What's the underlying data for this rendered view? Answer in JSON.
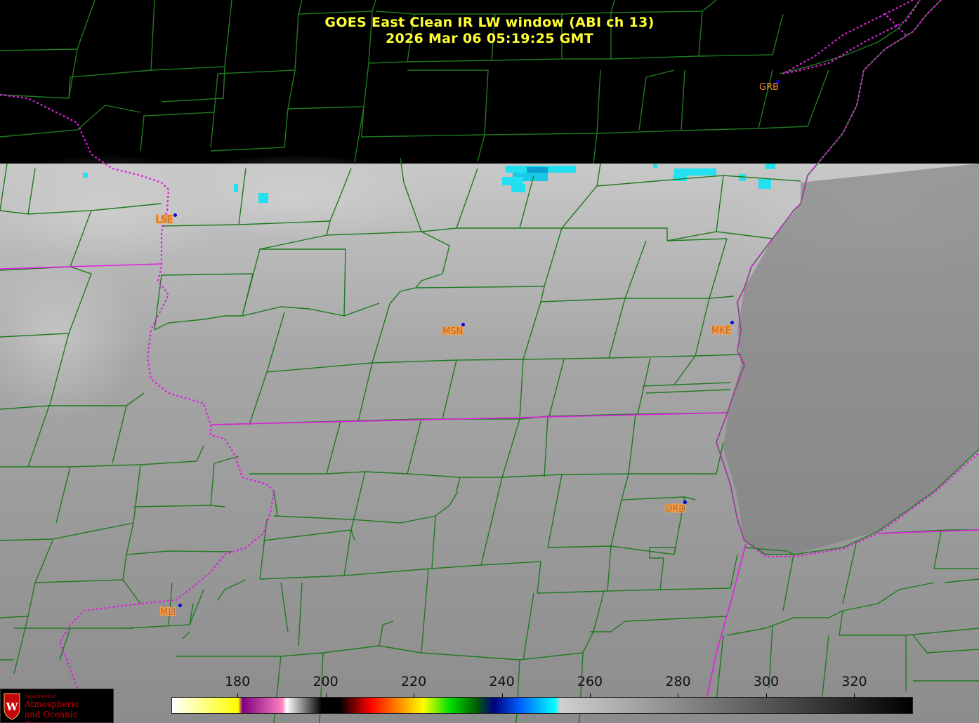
{
  "header": {
    "title_line1": "GOES East Clean IR LW window (ABI ch 13)",
    "title_line2": "2026 Mar 06  05:19:25 GMT"
  },
  "stations": [
    {
      "code": "GRB"
    },
    {
      "code": "LSE"
    },
    {
      "code": "MSN"
    },
    {
      "code": "MKE"
    },
    {
      "code": "ORD"
    },
    {
      "code": "MLI"
    }
  ],
  "colorbar": {
    "unit_range": [
      165,
      333
    ],
    "ticks": [
      "180",
      "200",
      "220",
      "240",
      "260",
      "280",
      "300",
      "320"
    ],
    "tick_values": [
      180,
      200,
      220,
      240,
      260,
      280,
      300,
      320
    ],
    "stops": [
      {
        "v": 165,
        "c": "#ffffff"
      },
      {
        "v": 180,
        "c": "#ffff00"
      },
      {
        "v": 181,
        "c": "#800080"
      },
      {
        "v": 190,
        "c": "#ff80c0"
      },
      {
        "v": 191,
        "c": "#ffffff"
      },
      {
        "v": 199,
        "c": "#000000"
      },
      {
        "v": 203,
        "c": "#000000"
      },
      {
        "v": 210,
        "c": "#ff0000"
      },
      {
        "v": 216,
        "c": "#ff8000"
      },
      {
        "v": 222,
        "c": "#ffff00"
      },
      {
        "v": 228,
        "c": "#00e000"
      },
      {
        "v": 234,
        "c": "#006000"
      },
      {
        "v": 238,
        "c": "#000080"
      },
      {
        "v": 244,
        "c": "#0060ff"
      },
      {
        "v": 252,
        "c": "#00ffff"
      },
      {
        "v": 253,
        "c": "#d0d0d0"
      },
      {
        "v": 333,
        "c": "#000000"
      }
    ]
  },
  "logo": {
    "small_text": "Department of",
    "line1": "Atmospheric",
    "line2": "and Oceanic Sciences"
  },
  "colors": {
    "county_lines": "#1f7a1f",
    "state_lines": "#e020e0",
    "title": "#ffff33",
    "station_label": "#f08a2a",
    "station_dot": "#0000dd"
  }
}
